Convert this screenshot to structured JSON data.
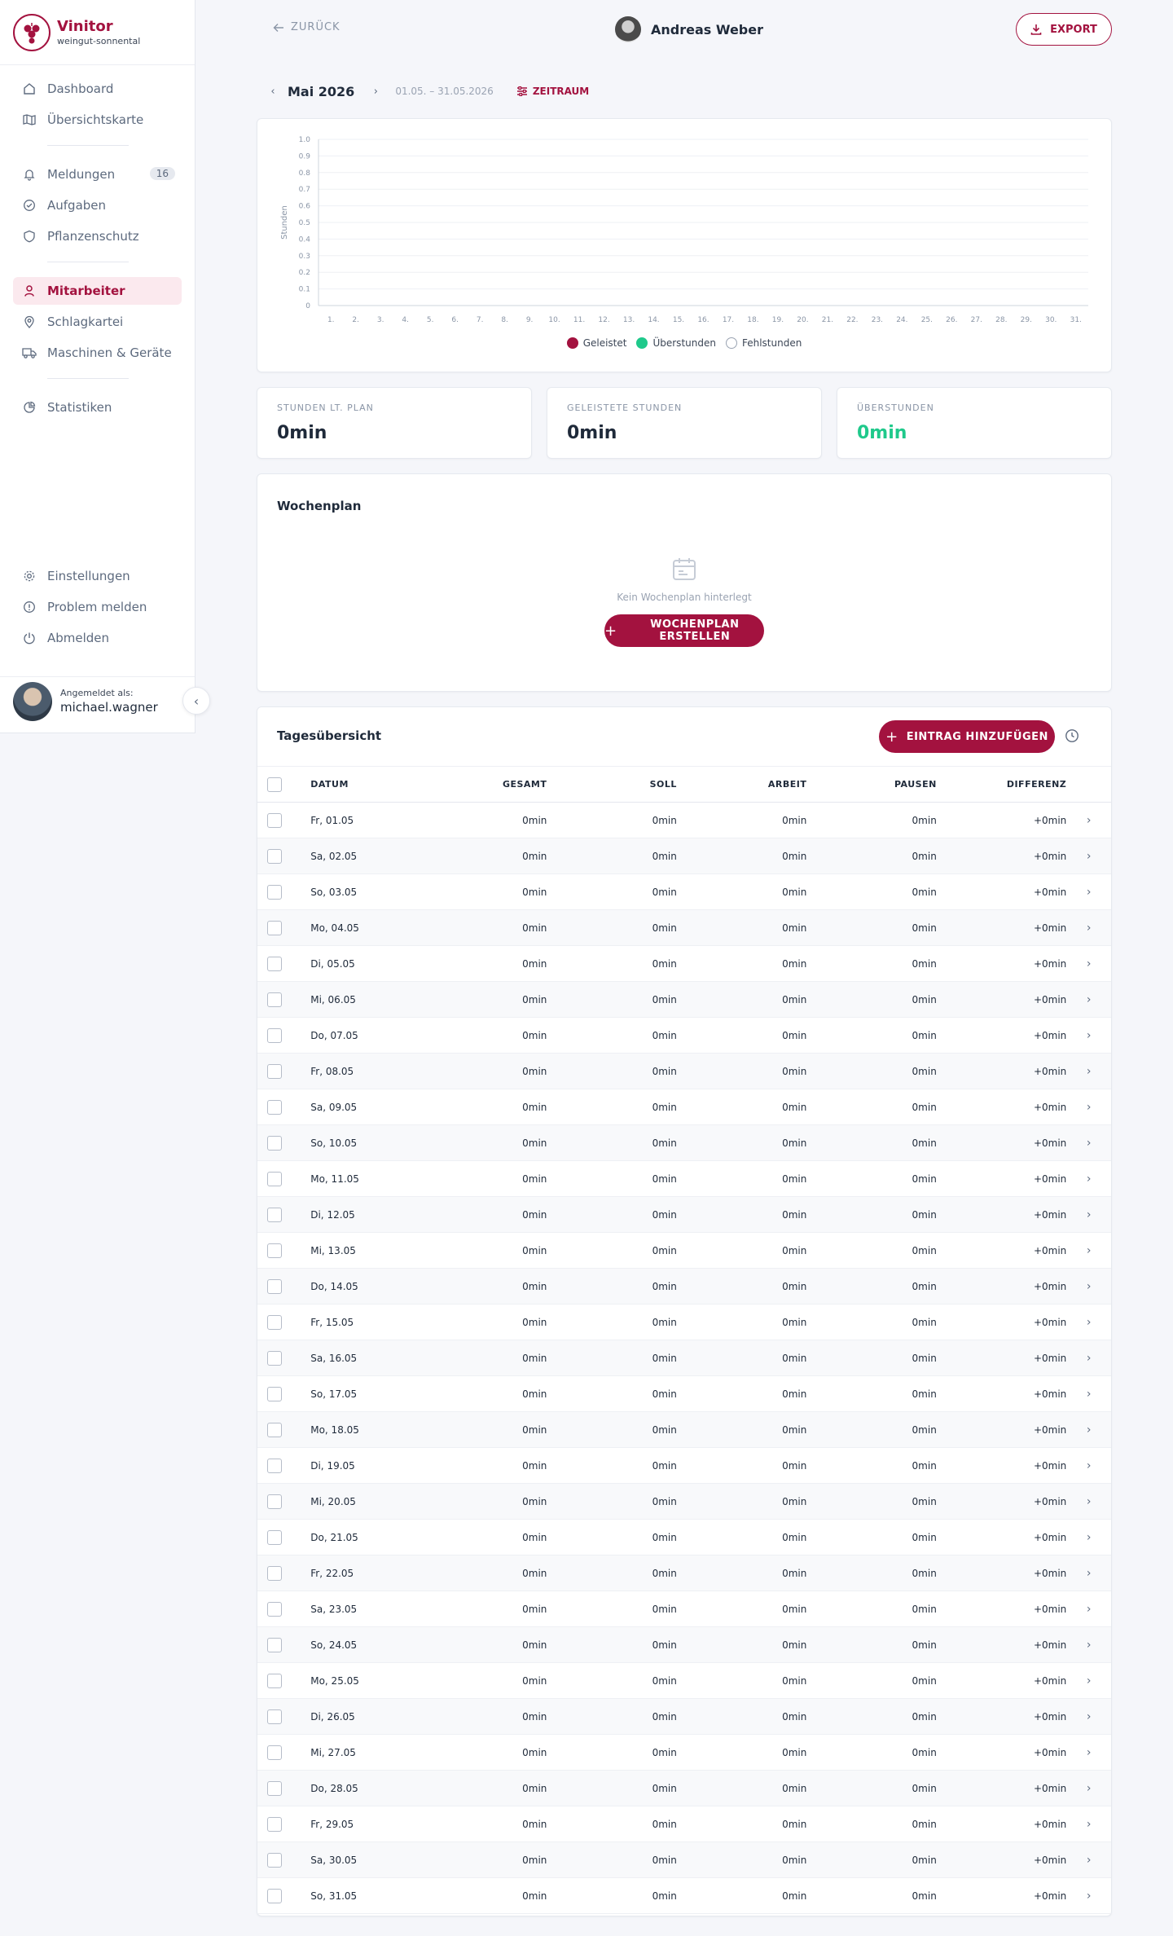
{
  "brand": {
    "name": "Vinitor",
    "sub": "weingut-sonnental"
  },
  "nav": {
    "main": [
      {
        "label": "Dashboard",
        "icon": "home-icon"
      },
      {
        "label": "Übersichtskarte",
        "icon": "map-icon"
      }
    ],
    "work": [
      {
        "label": "Meldungen",
        "icon": "bell-icon",
        "badge": "16"
      },
      {
        "label": "Aufgaben",
        "icon": "check-circle-icon"
      },
      {
        "label": "Pflanzenschutz",
        "icon": "shield-icon"
      }
    ],
    "resources": [
      {
        "label": "Mitarbeiter",
        "icon": "user-icon",
        "active": true
      },
      {
        "label": "Schlagkartei",
        "icon": "map-pin-icon"
      },
      {
        "label": "Maschinen & Geräte",
        "icon": "truck-icon"
      }
    ],
    "stats": [
      {
        "label": "Statistiken",
        "icon": "pie-chart-icon"
      }
    ],
    "bottom": [
      {
        "label": "Einstellungen",
        "icon": "gear-icon"
      },
      {
        "label": "Problem melden",
        "icon": "alert-circle-icon"
      },
      {
        "label": "Abmelden",
        "icon": "power-icon"
      }
    ]
  },
  "user": {
    "prefix": "Angemeldet als:",
    "name": "michael.wagner"
  },
  "header": {
    "back": "ZURÜCK",
    "employee": "Andreas Weber",
    "export": "EXPORT"
  },
  "period": {
    "month": "Mai 2026",
    "range": "01.05. – 31.05.2026",
    "filter": "ZEITRAUM"
  },
  "chart_data": {
    "type": "bar",
    "ylabel": "Stunden",
    "ylim": [
      0,
      1.0
    ],
    "yticks": [
      "0",
      "0.1",
      "0.2",
      "0.3",
      "0.4",
      "0.5",
      "0.6",
      "0.7",
      "0.8",
      "0.9",
      "1.0"
    ],
    "categories": [
      "1.",
      "2.",
      "3.",
      "4.",
      "5.",
      "6.",
      "7.",
      "8.",
      "9.",
      "10.",
      "11.",
      "12.",
      "13.",
      "14.",
      "15.",
      "16.",
      "17.",
      "18.",
      "19.",
      "20.",
      "21.",
      "22.",
      "23.",
      "24.",
      "25.",
      "26.",
      "27.",
      "28.",
      "29.",
      "30.",
      "31."
    ],
    "series": [
      {
        "name": "Geleistet",
        "color": "#a3123f",
        "values": [
          0,
          0,
          0,
          0,
          0,
          0,
          0,
          0,
          0,
          0,
          0,
          0,
          0,
          0,
          0,
          0,
          0,
          0,
          0,
          0,
          0,
          0,
          0,
          0,
          0,
          0,
          0,
          0,
          0,
          0,
          0
        ]
      },
      {
        "name": "Überstunden",
        "color": "#1fc98b",
        "values": [
          0,
          0,
          0,
          0,
          0,
          0,
          0,
          0,
          0,
          0,
          0,
          0,
          0,
          0,
          0,
          0,
          0,
          0,
          0,
          0,
          0,
          0,
          0,
          0,
          0,
          0,
          0,
          0,
          0,
          0,
          0
        ]
      },
      {
        "name": "Fehlstunden",
        "color": "#ffffff",
        "values": [
          0,
          0,
          0,
          0,
          0,
          0,
          0,
          0,
          0,
          0,
          0,
          0,
          0,
          0,
          0,
          0,
          0,
          0,
          0,
          0,
          0,
          0,
          0,
          0,
          0,
          0,
          0,
          0,
          0,
          0,
          0
        ]
      }
    ],
    "grid": true,
    "legend": "bottom-center"
  },
  "stats": [
    {
      "label": "STUNDEN LT. PLAN",
      "value": "0min",
      "color": "#1f2a3a"
    },
    {
      "label": "GELEISTETE STUNDEN",
      "value": "0min",
      "color": "#1f2a3a"
    },
    {
      "label": "ÜBERSTUNDEN",
      "value": "0min",
      "color": "#1fc98b"
    }
  ],
  "wochenplan": {
    "title": "Wochenplan",
    "empty": "Kein Wochenplan hinterlegt",
    "button": "WOCHENPLAN ERSTELLEN"
  },
  "tages": {
    "title": "Tagesübersicht",
    "add_button": "EINTRAG HINZUFÜGEN",
    "columns": [
      "DATUM",
      "GESAMT",
      "SOLL",
      "ARBEIT",
      "PAUSEN",
      "DIFFERENZ"
    ],
    "rows": [
      [
        "Fr, 01.05",
        "0min",
        "0min",
        "0min",
        "0min",
        "+0min"
      ],
      [
        "Sa, 02.05",
        "0min",
        "0min",
        "0min",
        "0min",
        "+0min"
      ],
      [
        "So, 03.05",
        "0min",
        "0min",
        "0min",
        "0min",
        "+0min"
      ],
      [
        "Mo, 04.05",
        "0min",
        "0min",
        "0min",
        "0min",
        "+0min"
      ],
      [
        "Di, 05.05",
        "0min",
        "0min",
        "0min",
        "0min",
        "+0min"
      ],
      [
        "Mi, 06.05",
        "0min",
        "0min",
        "0min",
        "0min",
        "+0min"
      ],
      [
        "Do, 07.05",
        "0min",
        "0min",
        "0min",
        "0min",
        "+0min"
      ],
      [
        "Fr, 08.05",
        "0min",
        "0min",
        "0min",
        "0min",
        "+0min"
      ],
      [
        "Sa, 09.05",
        "0min",
        "0min",
        "0min",
        "0min",
        "+0min"
      ],
      [
        "So, 10.05",
        "0min",
        "0min",
        "0min",
        "0min",
        "+0min"
      ],
      [
        "Mo, 11.05",
        "0min",
        "0min",
        "0min",
        "0min",
        "+0min"
      ],
      [
        "Di, 12.05",
        "0min",
        "0min",
        "0min",
        "0min",
        "+0min"
      ],
      [
        "Mi, 13.05",
        "0min",
        "0min",
        "0min",
        "0min",
        "+0min"
      ],
      [
        "Do, 14.05",
        "0min",
        "0min",
        "0min",
        "0min",
        "+0min"
      ],
      [
        "Fr, 15.05",
        "0min",
        "0min",
        "0min",
        "0min",
        "+0min"
      ],
      [
        "Sa, 16.05",
        "0min",
        "0min",
        "0min",
        "0min",
        "+0min"
      ],
      [
        "So, 17.05",
        "0min",
        "0min",
        "0min",
        "0min",
        "+0min"
      ],
      [
        "Mo, 18.05",
        "0min",
        "0min",
        "0min",
        "0min",
        "+0min"
      ],
      [
        "Di, 19.05",
        "0min",
        "0min",
        "0min",
        "0min",
        "+0min"
      ],
      [
        "Mi, 20.05",
        "0min",
        "0min",
        "0min",
        "0min",
        "+0min"
      ],
      [
        "Do, 21.05",
        "0min",
        "0min",
        "0min",
        "0min",
        "+0min"
      ],
      [
        "Fr, 22.05",
        "0min",
        "0min",
        "0min",
        "0min",
        "+0min"
      ],
      [
        "Sa, 23.05",
        "0min",
        "0min",
        "0min",
        "0min",
        "+0min"
      ],
      [
        "So, 24.05",
        "0min",
        "0min",
        "0min",
        "0min",
        "+0min"
      ],
      [
        "Mo, 25.05",
        "0min",
        "0min",
        "0min",
        "0min",
        "+0min"
      ],
      [
        "Di, 26.05",
        "0min",
        "0min",
        "0min",
        "0min",
        "+0min"
      ],
      [
        "Mi, 27.05",
        "0min",
        "0min",
        "0min",
        "0min",
        "+0min"
      ],
      [
        "Do, 28.05",
        "0min",
        "0min",
        "0min",
        "0min",
        "+0min"
      ],
      [
        "Fr, 29.05",
        "0min",
        "0min",
        "0min",
        "0min",
        "+0min"
      ],
      [
        "Sa, 30.05",
        "0min",
        "0min",
        "0min",
        "0min",
        "+0min"
      ],
      [
        "So, 31.05",
        "0min",
        "0min",
        "0min",
        "0min",
        "+0min"
      ]
    ]
  }
}
